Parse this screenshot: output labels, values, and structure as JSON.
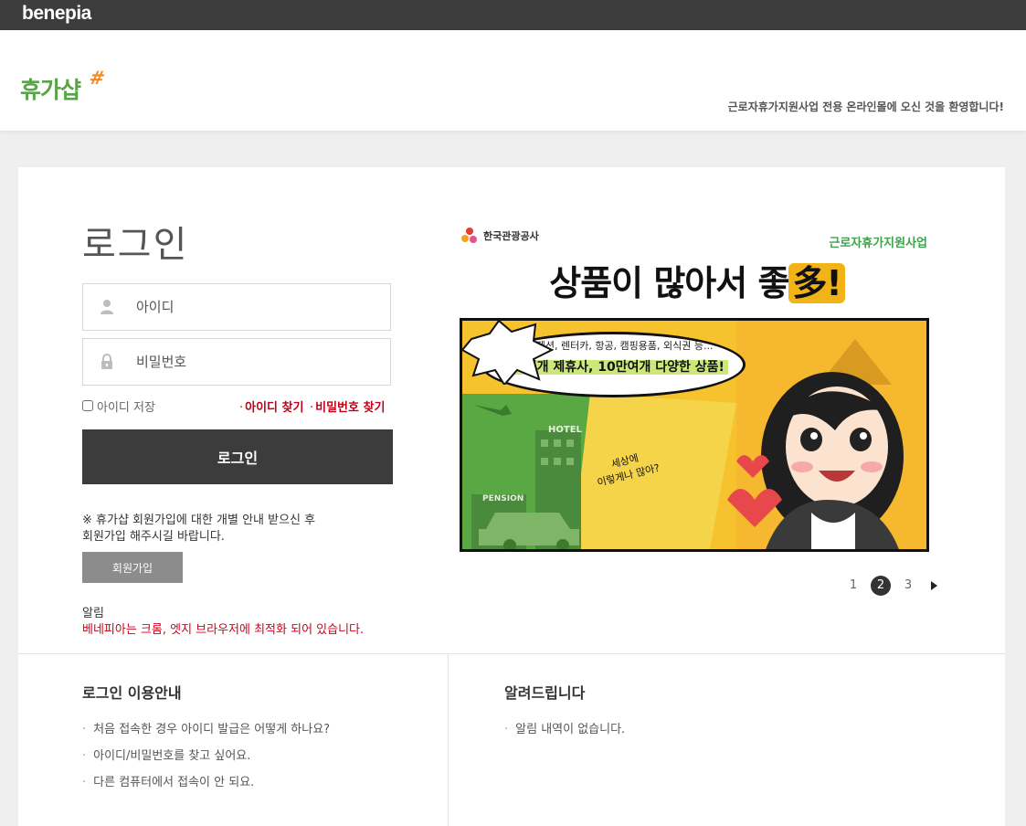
{
  "topbar": {
    "brand": "benepia"
  },
  "header": {
    "logo_text": "휴가샵",
    "logo_mark": "#",
    "welcome": "근로자휴가지원사업 전용 온라인몰에 오신 것을 환영합니다!"
  },
  "login": {
    "title": "로그인",
    "id_placeholder": "아이디",
    "pw_placeholder": "비밀번호",
    "save_id": "아이디 저장",
    "find_id": "아이디 찾기",
    "find_pw": "비밀번호 찾기",
    "submit": "로그인",
    "notice_line1": "※ 휴가샵 회원가입에 대한 개별 안내 받으신 후",
    "notice_line2": "회원가입 해주시길 바랍니다.",
    "join": "회원가입",
    "alert_label": "알림",
    "alert_text": "베네피아는 크롬, 엣지 브라우저에 최적화 되어 있습니다."
  },
  "banner": {
    "org": "한국관광공사",
    "program": "근로자휴가지원사업",
    "headline_main": "상품이 많아서 좋",
    "headline_accent": "多!",
    "sub1": "호텔, 펜션, 렌터카, 항공, 캠핑용품, 외식권 등...",
    "sub2": "4O여개 제휴사, 10만여개 다양한 상품!",
    "hotel": "HOTEL",
    "pension": "PENSION",
    "spark_line1": "세상에",
    "spark_line2": "이렇게나 많아?"
  },
  "pager": {
    "pages": [
      "1",
      "2",
      "3"
    ],
    "active": "2"
  },
  "guide": {
    "title": "로그인 이용안내",
    "items": [
      "처음 접속한 경우 아이디 발급은 어떻게 하나요?",
      "아이디/비밀번호를 찾고 싶어요.",
      "다른 컴퓨터에서 접속이 안 되요."
    ]
  },
  "news": {
    "title": "알려드립니다",
    "items": [
      "알림 내역이 없습니다."
    ]
  }
}
